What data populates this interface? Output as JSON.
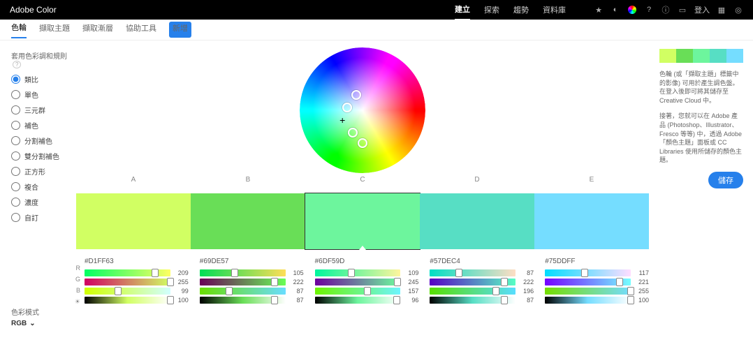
{
  "brand": "Adobe Color",
  "topnav": [
    "建立",
    "探索",
    "趨勢",
    "資料庫"
  ],
  "topnav_active": 0,
  "login": "登入",
  "subnav": [
    "色輪",
    "擷取主題",
    "擷取漸層",
    "協助工具"
  ],
  "subnav_badge": "新增",
  "harmony_label": "套用色彩調和規則",
  "help_icon": "?",
  "rules": [
    "類比",
    "單色",
    "三元群",
    "補色",
    "分割補色",
    "雙分割補色",
    "正方形",
    "複合",
    "濃度",
    "自訂"
  ],
  "rules_selected": 0,
  "colormode_label": "色彩模式",
  "colormode_value": "RGB",
  "swatch_letters": [
    "A",
    "B",
    "C",
    "D",
    "E"
  ],
  "swatches": [
    {
      "hex": "#D1FF63",
      "r": 209,
      "g": 255,
      "b": 99,
      "bright": 100
    },
    {
      "hex": "#69DE57",
      "r": 105,
      "g": 222,
      "b": 87,
      "bright": 87
    },
    {
      "hex": "#6DF59D",
      "r": 109,
      "g": 245,
      "b": 157,
      "bright": 96
    },
    {
      "hex": "#57DEC4",
      "r": 87,
      "g": 222,
      "b": 196,
      "bright": 87
    },
    {
      "hex": "#75DDFF",
      "r": 117,
      "g": 221,
      "b": 255,
      "bright": 100
    }
  ],
  "active_swatch": 2,
  "channels": [
    "R",
    "G",
    "B",
    "☀"
  ],
  "right_info1": "色輪 (或「擷取主題」標籤中的影像) 可用於產生調色盤。在登入後即可將其儲存至 Creative Cloud 中。",
  "right_info2": "接著，您就可以在 Adobe 產品 (Photoshop、Illustrator、Fresco 等等) 中，透過 Adobe「顏色主題」面板或 CC Libraries 使用所儲存的顏色主題。",
  "save_label": "儲存"
}
